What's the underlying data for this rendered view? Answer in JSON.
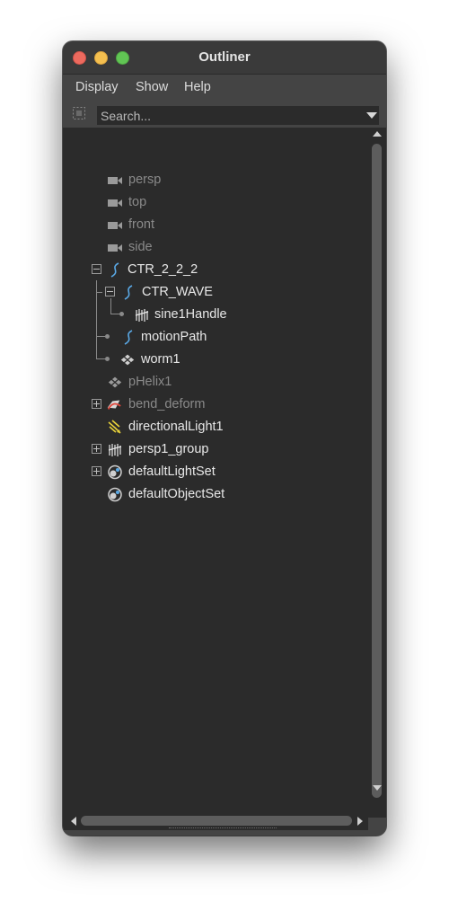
{
  "window": {
    "title": "Outliner"
  },
  "menu": {
    "items": [
      "Display",
      "Show",
      "Help"
    ]
  },
  "search": {
    "placeholder": "Search..."
  },
  "tree": {
    "items": [
      {
        "label": "persp",
        "icon": "camera-icon",
        "dimmed": true
      },
      {
        "label": "top",
        "icon": "camera-icon",
        "dimmed": true
      },
      {
        "label": "front",
        "icon": "camera-icon",
        "dimmed": true
      },
      {
        "label": "side",
        "icon": "camera-icon",
        "dimmed": true
      },
      {
        "label": "CTR_2_2_2",
        "icon": "curve-icon",
        "expanded": true
      },
      {
        "label": "CTR_WAVE",
        "icon": "curve-icon",
        "expanded": true
      },
      {
        "label": "sine1Handle",
        "icon": "deformer-handle-icon"
      },
      {
        "label": "motionPath",
        "icon": "curve-icon"
      },
      {
        "label": "worm1",
        "icon": "mesh-icon"
      },
      {
        "label": "pHelix1",
        "icon": "mesh-icon",
        "dimmed": true
      },
      {
        "label": "bend_deform",
        "icon": "bend-deformer-icon",
        "dimmed": true,
        "collapsed": true
      },
      {
        "label": "directionalLight1",
        "icon": "directional-light-icon"
      },
      {
        "label": "persp1_group",
        "icon": "group-icon",
        "collapsed": true
      },
      {
        "label": "defaultLightSet",
        "icon": "set-icon",
        "collapsed": true
      },
      {
        "label": "defaultObjectSet",
        "icon": "set-icon"
      }
    ]
  },
  "colors": {
    "panel_bg": "#444444",
    "tree_bg": "#2b2b2b",
    "text": "#e8e8e8",
    "dim_text": "#8a8a8a",
    "curve_blue": "#5aa9e6",
    "light_yellow": "#e8d23a"
  }
}
